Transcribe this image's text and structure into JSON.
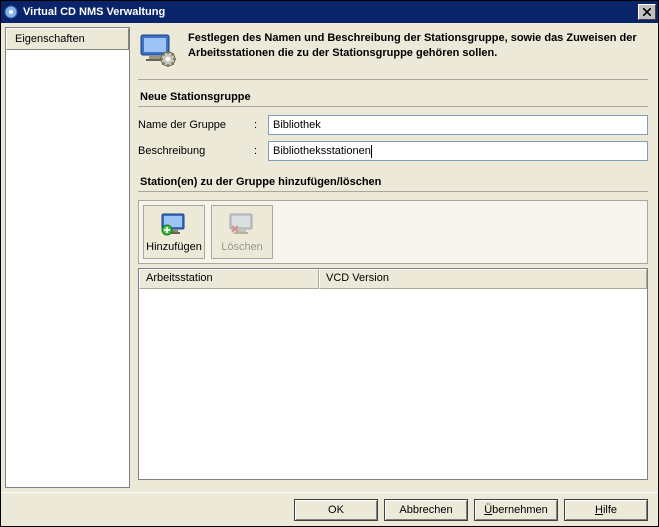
{
  "window": {
    "title": "Virtual CD NMS Verwaltung"
  },
  "sidebar": {
    "tabs": [
      {
        "label": "Eigenschaften"
      }
    ]
  },
  "header": {
    "text": "Festlegen des Namen und Beschreibung der Stationsgruppe, sowie das Zuweisen der Arbeitsstationen die zu der Stationsgruppe gehören sollen."
  },
  "form": {
    "group_title": "Neue Stationsgruppe",
    "name_label": "Name der Gruppe",
    "name_value": "Bibliothek",
    "desc_label": "Beschreibung",
    "desc_value": "Bibliotheksstationen"
  },
  "stations": {
    "group_title": "Station(en) zu der Gruppe hinzufügen/löschen",
    "add_label": "Hinzufügen",
    "del_label": "Löschen",
    "col1": "Arbeitsstation",
    "col2": "VCD Version"
  },
  "buttons": {
    "ok": "OK",
    "cancel": "Abbrechen",
    "apply": "Übernehmen",
    "help": "Hilfe"
  }
}
